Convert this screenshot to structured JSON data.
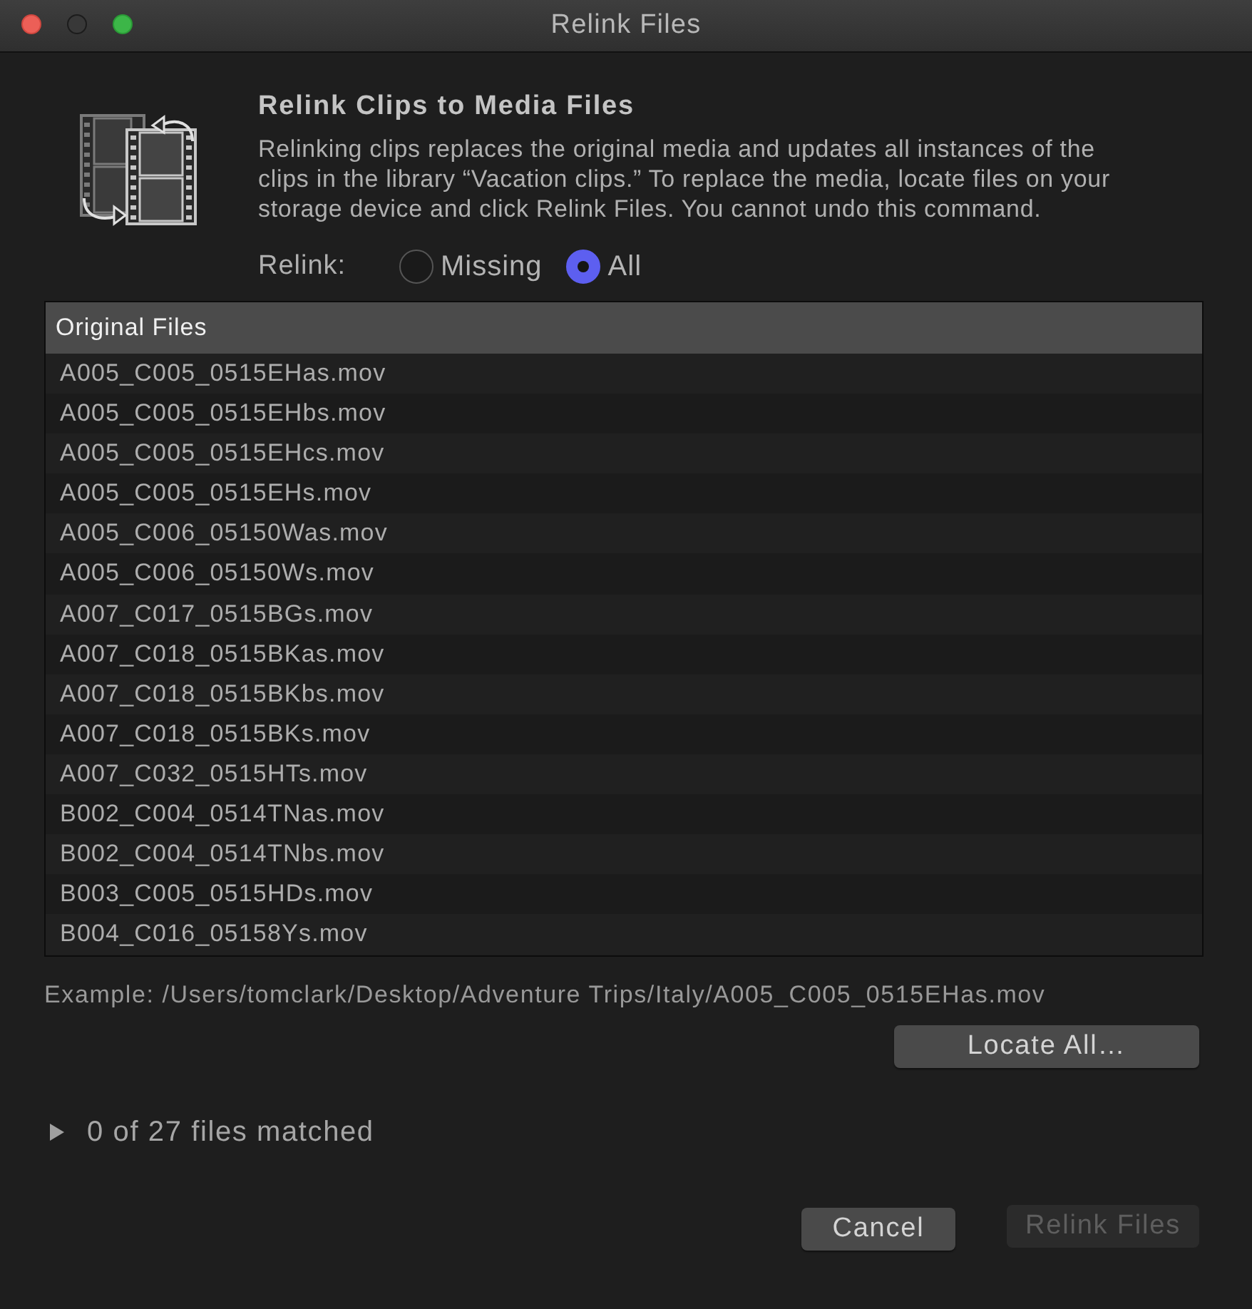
{
  "window": {
    "title": "Relink Files",
    "controls": [
      {
        "kind": "close",
        "disabled": false
      },
      {
        "kind": "minimize",
        "disabled": true
      },
      {
        "kind": "zoom",
        "disabled": false
      }
    ]
  },
  "header": {
    "title": "Relink Clips to Media Files",
    "description": "Relinking clips replaces the original media and updates all instances of the clips in the library “Vacation clips.” To replace the media, locate files on your storage device and click Relink Files. You cannot undo this command."
  },
  "relink": {
    "label": "Relink:",
    "options": [
      {
        "label": "Missing",
        "selected": false
      },
      {
        "label": "All",
        "selected": true
      }
    ]
  },
  "table": {
    "columns": [
      "Original Files"
    ],
    "rows": [
      "A005_C005_0515EHas.mov",
      "A005_C005_0515EHbs.mov",
      "A005_C005_0515EHcs.mov",
      "A005_C005_0515EHs.mov",
      "A005_C006_05150Was.mov",
      "A005_C006_05150Ws.mov",
      "A007_C017_0515BGs.mov",
      "A007_C018_0515BKas.mov",
      "A007_C018_0515BKbs.mov",
      "A007_C018_0515BKs.mov",
      "A007_C032_0515HTs.mov",
      "B002_C004_0514TNas.mov",
      "B002_C004_0514TNbs.mov",
      "B003_C005_0515HDs.mov",
      "B004_C016_05158Ys.mov"
    ]
  },
  "example": "Example: /Users/tomclark/Desktop/Adventure Trips/Italy/A005_C005_0515EHas.mov",
  "locate_button": {
    "label": "Locate All…",
    "disabled": false
  },
  "matched": {
    "label": "0 of 27 files matched",
    "expanded": false
  },
  "buttons": [
    {
      "label": "Cancel",
      "disabled": false
    },
    {
      "label": "Relink Files",
      "disabled": true
    }
  ]
}
